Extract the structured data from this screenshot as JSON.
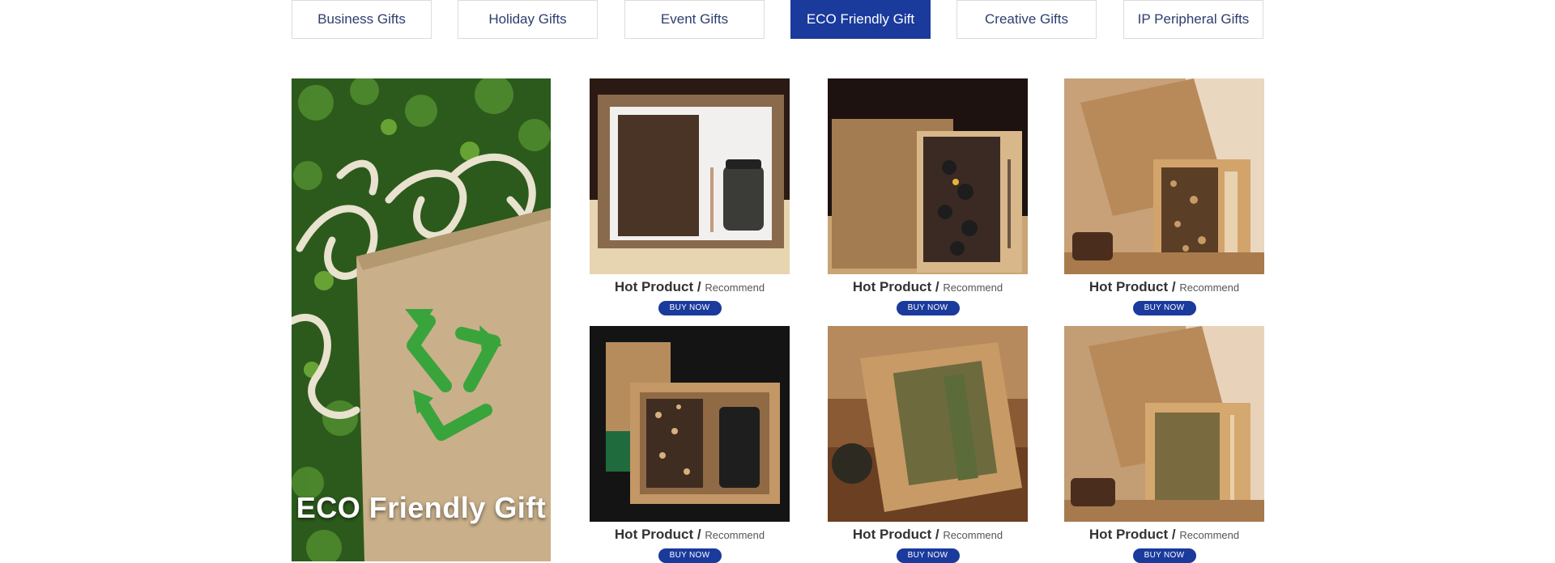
{
  "tabs": [
    {
      "label": "Business Gifts",
      "active": false
    },
    {
      "label": "Holiday Gifts",
      "active": false
    },
    {
      "label": "Event Gifts",
      "active": false
    },
    {
      "label": "ECO Friendly Gift",
      "active": true
    },
    {
      "label": "Creative Gifts",
      "active": false
    },
    {
      "label": "IP Peripheral Gifts",
      "active": false
    }
  ],
  "hero": {
    "title": "ECO Friendly Gift"
  },
  "products": [
    {
      "title": "Hot Product",
      "separator": "/",
      "subtitle": "Recommend",
      "button": "BUY NOW"
    },
    {
      "title": "Hot Product",
      "separator": "/",
      "subtitle": "Recommend",
      "button": "BUY NOW"
    },
    {
      "title": "Hot Product",
      "separator": "/",
      "subtitle": "Recommend",
      "button": "BUY NOW"
    },
    {
      "title": "Hot Product",
      "separator": "/",
      "subtitle": "Recommend",
      "button": "BUY NOW"
    },
    {
      "title": "Hot Product",
      "separator": "/",
      "subtitle": "Recommend",
      "button": "BUY NOW"
    },
    {
      "title": "Hot Product",
      "separator": "/",
      "subtitle": "Recommend",
      "button": "BUY NOW"
    }
  ],
  "colors": {
    "accent": "#1a3a9c",
    "tab_text": "#2d3d6e",
    "recycle_green": "#3aa43c"
  }
}
